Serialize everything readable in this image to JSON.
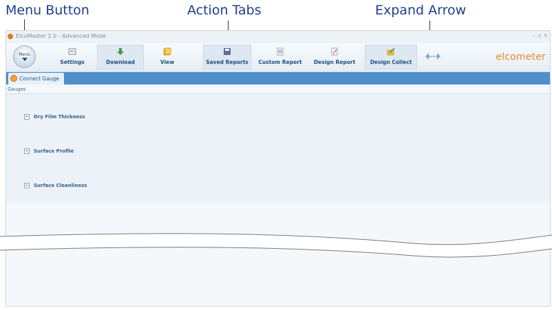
{
  "annotations": {
    "menu_button": "Menu Button",
    "action_tabs": "Action Tabs",
    "expand_arrow": "Expand Arrow"
  },
  "window": {
    "title": "ElcoMaster 2.0 - Advanced Mode",
    "controls": [
      "–",
      "▫",
      "×"
    ]
  },
  "ribbon": {
    "menu_label": "Menu",
    "tabs": [
      {
        "label": "Settings",
        "icon": "settings-icon"
      },
      {
        "label": "Download",
        "icon": "download-arrow-icon"
      },
      {
        "label": "View",
        "icon": "folder-icon"
      },
      {
        "label": "Saved Reports",
        "icon": "saved-reports-icon"
      },
      {
        "label": "Custom Report",
        "icon": "custom-report-icon"
      },
      {
        "label": "Design Report",
        "icon": "design-report-icon"
      },
      {
        "label": "Design Collect",
        "icon": "design-collect-icon"
      }
    ],
    "expand_icon": "expand-arrow-icon",
    "brand": "elcometer"
  },
  "connect": {
    "label": "Connect Gauge"
  },
  "gauges": {
    "header": "Gauges",
    "items": [
      "Dry Film Thickness",
      "Surface Profile",
      "Surface Cleanliness"
    ]
  },
  "colors": {
    "accent": "#4f8fcb",
    "brand": "#e5892f",
    "annotation": "#1f3d8c"
  }
}
